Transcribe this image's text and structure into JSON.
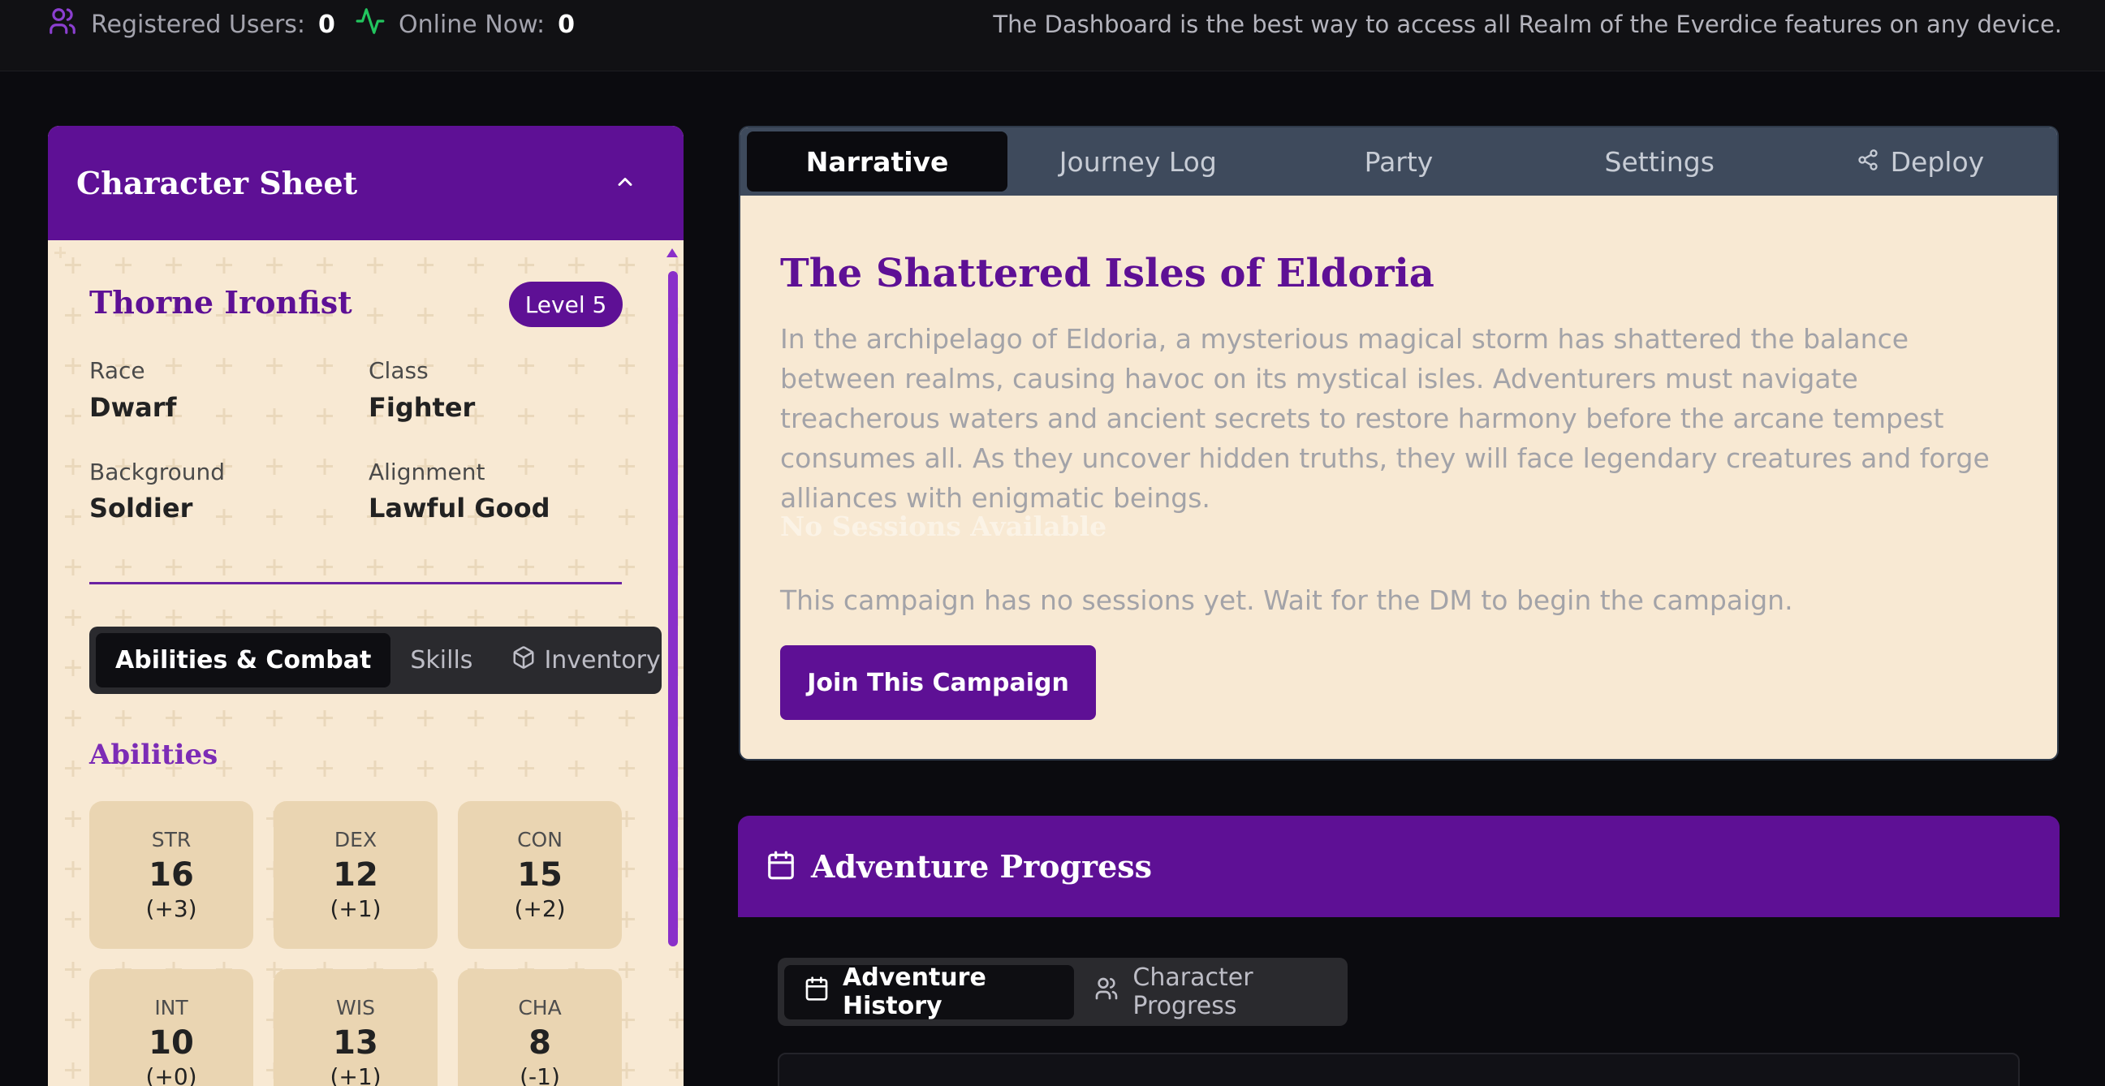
{
  "topbar": {
    "registered_label": "Registered Users:",
    "registered_count": "0",
    "online_label": "Online Now:",
    "online_count": "0",
    "note": "The Dashboard is the best way to access all Realm of the Everdice features on any device."
  },
  "character_sheet": {
    "title": "Character Sheet",
    "name": "Thorne Ironfist",
    "level": "Level 5",
    "attributes": [
      {
        "label": "Race",
        "value": "Dwarf"
      },
      {
        "label": "Class",
        "value": "Fighter"
      },
      {
        "label": "Background",
        "value": "Soldier"
      },
      {
        "label": "Alignment",
        "value": "Lawful Good"
      }
    ],
    "tabs": [
      {
        "label": "Abilities & Combat"
      },
      {
        "label": "Skills"
      },
      {
        "label": "Inventory"
      }
    ],
    "abilities_title": "Abilities",
    "abilities": [
      {
        "abbr": "STR",
        "score": "16",
        "mod": "(+3)"
      },
      {
        "abbr": "DEX",
        "score": "12",
        "mod": "(+1)"
      },
      {
        "abbr": "CON",
        "score": "15",
        "mod": "(+2)"
      },
      {
        "abbr": "INT",
        "score": "10",
        "mod": "(+0)"
      },
      {
        "abbr": "WIS",
        "score": "13",
        "mod": "(+1)"
      },
      {
        "abbr": "CHA",
        "score": "8",
        "mod": "(-1)"
      }
    ]
  },
  "main": {
    "tabs": [
      {
        "label": "Narrative"
      },
      {
        "label": "Journey Log"
      },
      {
        "label": "Party"
      },
      {
        "label": "Settings"
      },
      {
        "label": "Deploy"
      }
    ],
    "campaign_title": "The Shattered Isles of Eldoria",
    "campaign_description": "In the archipelago of Eldoria, a mysterious magical storm has shattered the balance between realms, causing havoc on its mystical isles. Adventurers must navigate treacherous waters and ancient secrets to restore harmony before the arcane tempest consumes all. As they uncover hidden truths, they will face legendary creatures and forge alliances with enigmatic beings.",
    "no_sessions_title": "No Sessions Available",
    "no_sessions_text": "This campaign has no sessions yet. Wait for the DM to begin the campaign.",
    "join_button": "Join This Campaign"
  },
  "progress": {
    "title": "Adventure Progress",
    "tabs": [
      {
        "label": "Adventure History"
      },
      {
        "label": "Character Progress"
      }
    ]
  },
  "colors": {
    "brand_purple": "#5e1095",
    "accent_purple": "#8a2fc9",
    "parchment": "#f8e9d3",
    "online_green": "#22c55e"
  }
}
